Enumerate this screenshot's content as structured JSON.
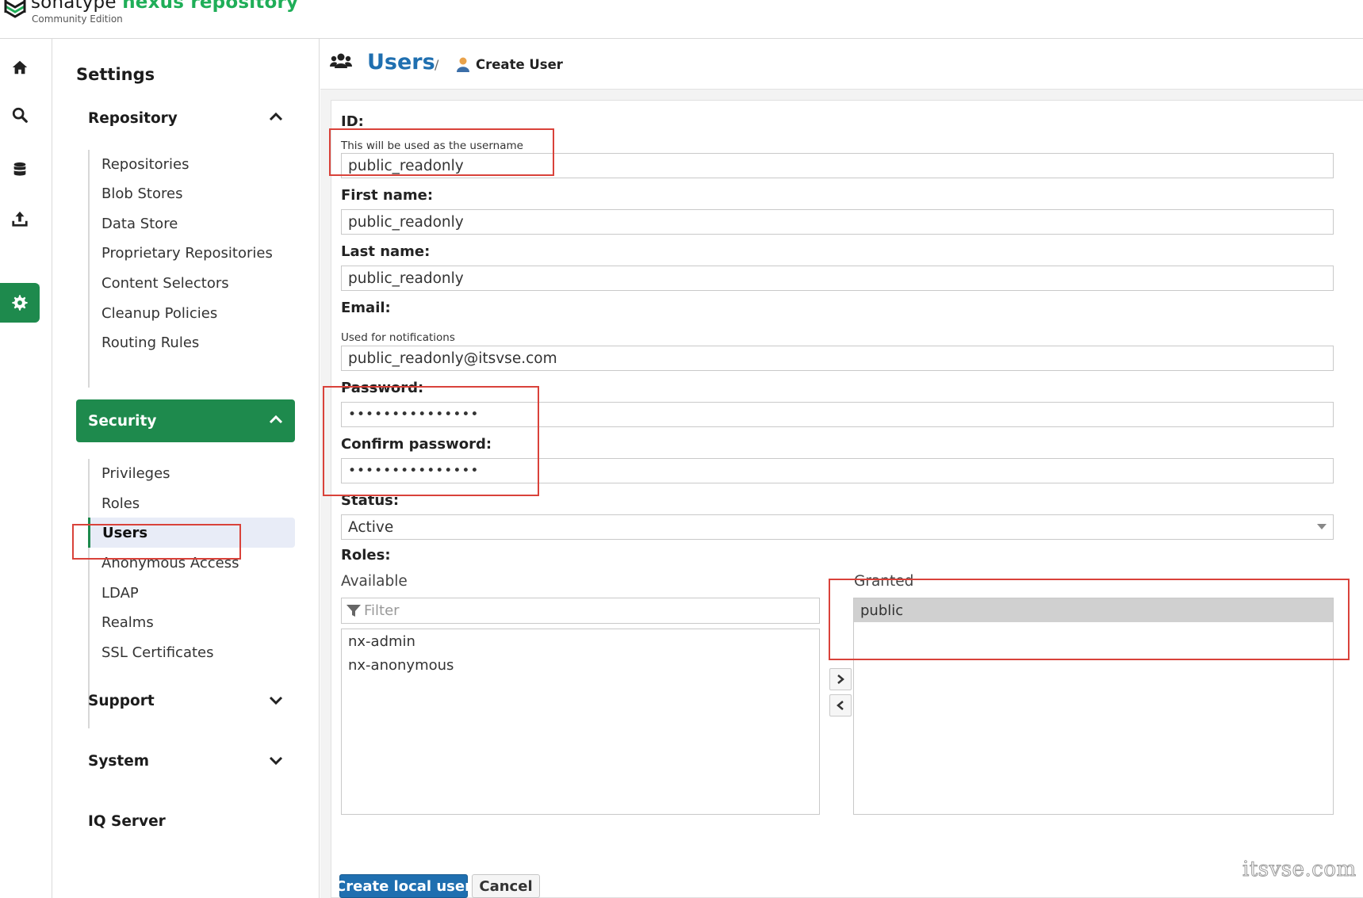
{
  "header": {
    "brand_prefix": "sonatype",
    "brand_product": "nexus repository",
    "edition": "Community Edition"
  },
  "rail": {
    "icons": [
      "home-icon",
      "search-icon",
      "database-icon",
      "upload-icon",
      "gear-icon"
    ],
    "active": "gear-icon",
    "accent": "#1e8a4d"
  },
  "nav": {
    "title": "Settings",
    "sections": {
      "repository": {
        "label": "Repository",
        "items": [
          "Repositories",
          "Blob Stores",
          "Data Store",
          "Proprietary Repositories",
          "Content Selectors",
          "Cleanup Policies",
          "Routing Rules"
        ]
      },
      "security": {
        "label": "Security",
        "items": [
          "Privileges",
          "Roles",
          "Users",
          "Anonymous Access",
          "LDAP",
          "Realms",
          "SSL Certificates"
        ]
      },
      "support": {
        "label": "Support"
      },
      "system": {
        "label": "System"
      },
      "iq": {
        "label": "IQ Server"
      }
    }
  },
  "breadcrumb": {
    "section": "Users",
    "separator": "/",
    "page": "Create User"
  },
  "form": {
    "id": {
      "label": "ID:",
      "hint": "This will be used as the username",
      "value": "public_readonly"
    },
    "first_name": {
      "label": "First name:",
      "value": "public_readonly"
    },
    "last_name": {
      "label": "Last name:",
      "value": "public_readonly"
    },
    "email": {
      "label": "Email:",
      "hint": "Used for notifications",
      "value": "public_readonly@itsvse.com"
    },
    "password": {
      "label": "Password:",
      "value": "•••••••••••••••"
    },
    "confirm_password": {
      "label": "Confirm password:",
      "value": "•••••••••••••••"
    },
    "status": {
      "label": "Status:",
      "value": "Active"
    },
    "roles": {
      "label": "Roles:",
      "available_label": "Available",
      "filter_placeholder": "Filter",
      "available": [
        "nx-admin",
        "nx-anonymous"
      ],
      "granted_label": "Granted",
      "granted": [
        "public"
      ]
    },
    "create_button": "Create local user",
    "cancel_button": "Cancel"
  },
  "watermark": "itsvse.com",
  "colors": {
    "brand_green": "#1fae58",
    "link_blue": "#1f6fb0",
    "highlight_red": "#d9423a"
  }
}
